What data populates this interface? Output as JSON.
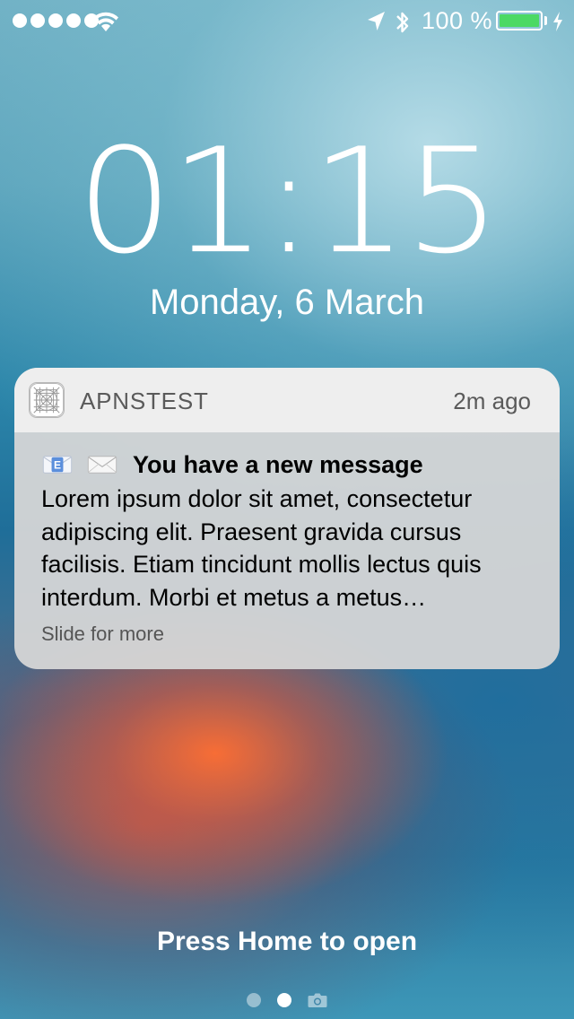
{
  "status_bar": {
    "signal_dots": 5,
    "battery_percent_label": "100 %",
    "battery_level": 1.0,
    "battery_color": "#4cd964",
    "icons": [
      "wifi-icon",
      "location-arrow-icon",
      "bluetooth-icon",
      "charging-bolt-icon"
    ]
  },
  "lock_screen": {
    "time": "01:15",
    "date": "Monday, 6 March",
    "press_home": "Press Home to open"
  },
  "notification": {
    "app_name": "APNSTEST",
    "time_ago": "2m ago",
    "title": "You have a new message",
    "body": "Lorem ipsum dolor sit amet, consectetur adipiscing elit. Praesent gravida cursus facilisis. Etiam tincidunt mollis lectus quis interdum. Morbi et metus a metus…",
    "slide_hint": "Slide for more",
    "title_icons": [
      "email-envelope-icon",
      "envelope-icon"
    ]
  },
  "pager": {
    "pages": 3,
    "active_index": 1,
    "page_icons": [
      "dot",
      "dot",
      "camera-icon"
    ]
  }
}
